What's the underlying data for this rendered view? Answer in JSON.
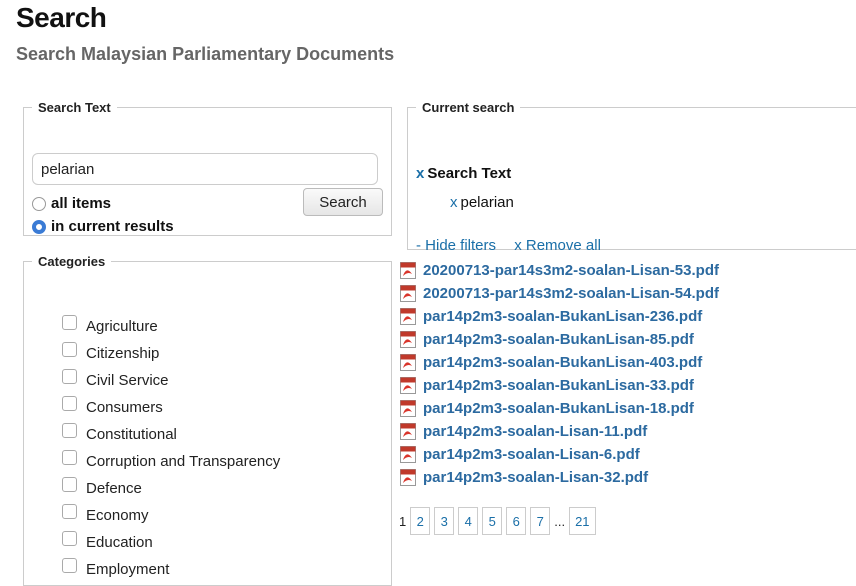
{
  "page": {
    "title": "Search",
    "subtitle": "Search Malaysian Parliamentary Documents"
  },
  "search_panel": {
    "legend": "Search Text",
    "query": "pelarian",
    "radio_all": "all items",
    "radio_current": "in current results",
    "selected_scope": "in current results",
    "button": "Search"
  },
  "current_search": {
    "legend": "Current search",
    "remove_mark": "x",
    "filter_label": "Search Text",
    "term": "pelarian",
    "hide_filters": "- Hide filters",
    "remove_all": "x Remove all"
  },
  "categories": {
    "legend": "Categories",
    "items": [
      "Agriculture",
      "Citizenship",
      "Civil Service",
      "Consumers",
      "Constitutional",
      "Corruption and Transparency",
      "Defence",
      "Economy",
      "Education",
      "Employment"
    ]
  },
  "results": {
    "icon": "pdf-file-icon",
    "files": [
      "20200713-par14s3m2-soalan-Lisan-53.pdf",
      "20200713-par14s3m2-soalan-Lisan-54.pdf",
      "par14p2m3-soalan-BukanLisan-236.pdf",
      "par14p2m3-soalan-BukanLisan-85.pdf",
      "par14p2m3-soalan-BukanLisan-403.pdf",
      "par14p2m3-soalan-BukanLisan-33.pdf",
      "par14p2m3-soalan-BukanLisan-18.pdf",
      "par14p2m3-soalan-Lisan-11.pdf",
      "par14p2m3-soalan-Lisan-6.pdf",
      "par14p2m3-soalan-Lisan-32.pdf"
    ]
  },
  "pager": {
    "current": "1",
    "pages": [
      "2",
      "3",
      "4",
      "5",
      "6",
      "7"
    ],
    "ellipsis": "...",
    "last": "21"
  },
  "colors": {
    "link": "#2c6aa0",
    "accent": "#3a7bd5",
    "subtitle": "#666666"
  }
}
